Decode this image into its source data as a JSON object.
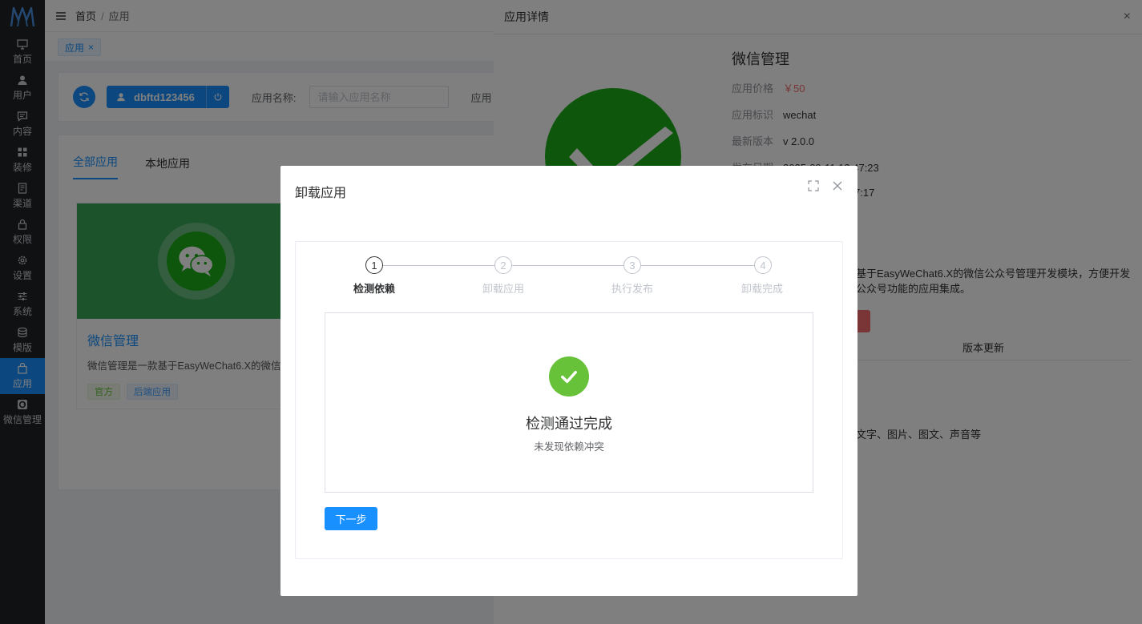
{
  "sidebar": {
    "items": [
      {
        "label": "首页",
        "icon": "monitor-icon"
      },
      {
        "label": "用户",
        "icon": "user-icon"
      },
      {
        "label": "内容",
        "icon": "comment-icon"
      },
      {
        "label": "装修",
        "icon": "grid-icon"
      },
      {
        "label": "渠道",
        "icon": "document-icon"
      },
      {
        "label": "权限",
        "icon": "lock-icon"
      },
      {
        "label": "设置",
        "icon": "gear-icon"
      },
      {
        "label": "系统",
        "icon": "sliders-icon"
      },
      {
        "label": "模版",
        "icon": "database-icon"
      },
      {
        "label": "应用",
        "icon": "bag-icon"
      },
      {
        "label": "微信管理",
        "icon": "wechat-icon"
      }
    ],
    "active_index": 9
  },
  "header": {
    "breadcrumb": [
      "首页",
      "应用"
    ],
    "breadcrumb_sep": "/"
  },
  "tags": {
    "active_tag": "应用",
    "close_glyph": "×"
  },
  "filter": {
    "username": "dbftd123456",
    "app_name_label": "应用名称:",
    "app_name_placeholder": "请输入应用名称",
    "second_label": "应用"
  },
  "app_list": {
    "tabs": [
      "全部应用",
      "本地应用"
    ],
    "active_tab": 0,
    "card": {
      "title": "微信管理",
      "desc": "微信管理是一款基于EasyWeChat6.X的微信",
      "tags": [
        "官方",
        "后端应用"
      ]
    }
  },
  "drawer": {
    "title": "应用详情",
    "close_glyph": "×",
    "app_title": "微信管理",
    "price_label": "应用价格",
    "price": "￥50",
    "key_label": "应用标识",
    "key": "wechat",
    "version_label": "最新版本",
    "version": "v 2.0.0",
    "publish_label": "发布日期",
    "publish_date": "2025-09-11 12:47:23",
    "update_time_partial": "7:17",
    "desc_line1": "基于EasyWeChat6.X的微信公众号管理开发模块，方便开发",
    "desc_line2": "公众号功能的应用集成。",
    "tab_label": "版本更新",
    "feature_partial": "文字、图片、图文、声音等"
  },
  "modal": {
    "title": "卸载应用",
    "steps": [
      {
        "num": "1",
        "label": "检测依赖"
      },
      {
        "num": "2",
        "label": "卸载应用"
      },
      {
        "num": "3",
        "label": "执行发布"
      },
      {
        "num": "4",
        "label": "卸载完成"
      }
    ],
    "current_step": 1,
    "result_title": "检测通过完成",
    "result_sub": "未发现依赖冲突",
    "next_label": "下一步"
  },
  "colors": {
    "primary": "#1890ff",
    "success": "#67c23a",
    "danger": "#f56c6c",
    "wechat_green": "#1aad19",
    "sidebar_bg": "#1f2227"
  }
}
